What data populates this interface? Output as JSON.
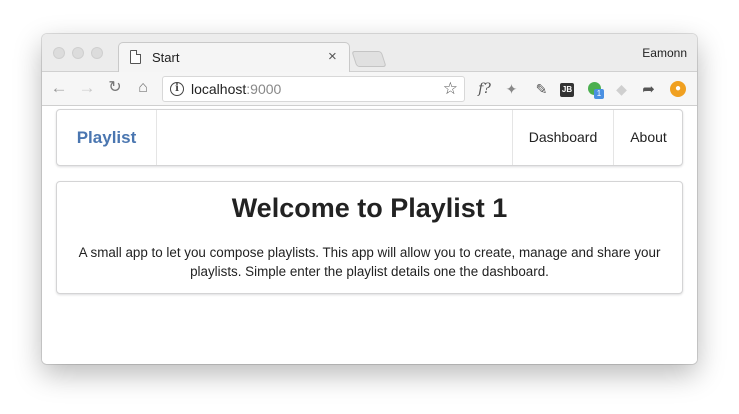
{
  "browser": {
    "tab_title": "Start",
    "tab_close": "×",
    "profile_name": "Eamonn",
    "url_host": "localhost",
    "url_port": ":9000",
    "nav_icons": {
      "back": "arrow-left-icon",
      "forward": "arrow-right-icon",
      "reload": "reload-icon",
      "home": "home-icon"
    },
    "extension_icons": [
      "fx-icon",
      "satellite-icon",
      "color-picker-icon",
      "jb-icon",
      "green-extension-icon",
      "dropbox-icon",
      "share-icon",
      "orange-extension-icon"
    ],
    "fx_label": "f?",
    "jb_label": "JB",
    "green_badge": "1"
  },
  "navbar": {
    "brand": "Playlist",
    "items": [
      {
        "label": "Dashboard"
      },
      {
        "label": "About"
      }
    ]
  },
  "main": {
    "title": "Welcome to Playlist 1",
    "description": "A small app to let you compose playlists. This app will allow you to create, manage and share your playlists. Simple enter the playlist details one the dashboard."
  },
  "colors": {
    "brand": "#4a76b0",
    "green_extension": "#4caf50",
    "orange_extension": "#f0a020"
  }
}
